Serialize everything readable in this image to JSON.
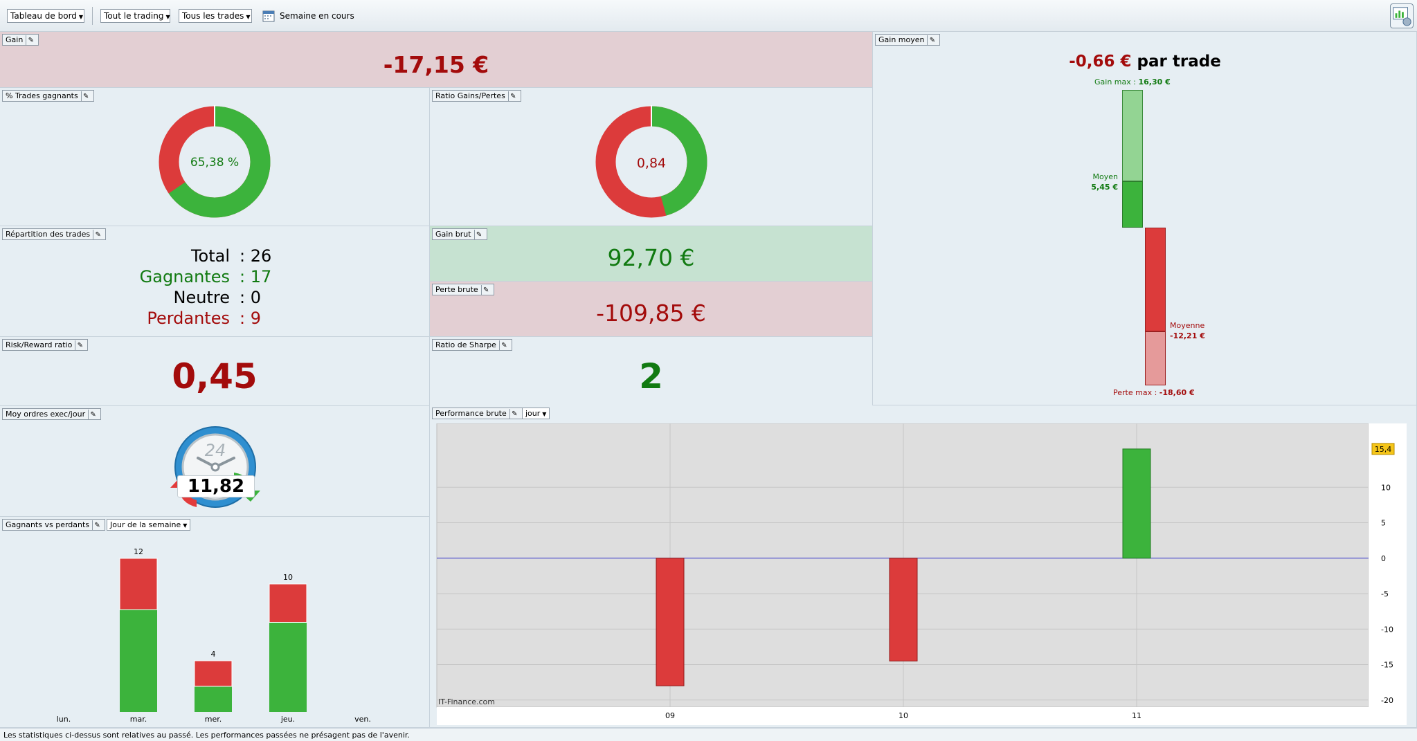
{
  "toolbar": {
    "dashboard": "Tableau de bord",
    "trading": "Tout le trading",
    "trades": "Tous les trades",
    "period": "Semaine en cours"
  },
  "gain": {
    "title": "Gain",
    "value": "-17,15 €"
  },
  "gain_moyen": {
    "title": "Gain moyen",
    "value": "-0,66 €",
    "suffix": "par trade",
    "max_label": "Gain max",
    "max_value": "16,30 €",
    "avg_gain_label": "Moyen",
    "avg_gain_value": "5,45 €",
    "avg_loss_label": "Moyenne",
    "avg_loss_value": "-12,21 €",
    "loss_max_label": "Perte max",
    "loss_max_value": "-18,60 €"
  },
  "win_pct": {
    "title": "% Trades gagnants",
    "value": "65,38 %",
    "fraction": 0.6538
  },
  "ratio_gp": {
    "title": "Ratio Gains/Pertes",
    "value": "0,84",
    "gain_share": 0.457
  },
  "repartition": {
    "title": "Répartition des trades",
    "rows": [
      {
        "label": "Total",
        "value": ": 26"
      },
      {
        "label": "Gagnantes",
        "value": ": 17"
      },
      {
        "label": "Neutre",
        "value": ": 0"
      },
      {
        "label": "Perdantes",
        "value": ": 9"
      }
    ]
  },
  "gain_brut": {
    "title": "Gain brut",
    "value": "92,70 €"
  },
  "perte_brute": {
    "title": "Perte brute",
    "value": "-109,85 €"
  },
  "risk_reward": {
    "title": "Risk/Reward ratio",
    "value": "0,45"
  },
  "sharpe": {
    "title": "Ratio de Sharpe",
    "value": "2"
  },
  "ordres": {
    "title": "Moy ordres exec/jour",
    "value": "11,82",
    "clock": "24"
  },
  "winners_losers": {
    "title": "Gagnants vs perdants",
    "dropdown": "Jour de la semaine"
  },
  "performance": {
    "title": "Performance brute",
    "dropdown": "jour",
    "watermark": "IT-Finance.com",
    "last_value": "15,4"
  },
  "footer": "Les statistiques ci-dessus sont relatives au passé. Les performances passées ne présagent pas de l'avenir.",
  "colors": {
    "green": "#3cb33c",
    "red": "#dc3b3b",
    "dark_red": "#a30b0b",
    "dark_green": "#117a11"
  },
  "chart_data": [
    {
      "type": "bar",
      "name": "Gagnants vs perdants",
      "categories": [
        "lun.",
        "mar.",
        "mer.",
        "jeu.",
        "ven."
      ],
      "series": [
        {
          "name": "Gagnants",
          "values": [
            0,
            8,
            2,
            7,
            0
          ]
        },
        {
          "name": "Perdants",
          "values": [
            0,
            4,
            2,
            3,
            0
          ]
        }
      ],
      "totals": [
        0,
        12,
        4,
        10,
        0
      ],
      "ylim": [
        0,
        12
      ]
    },
    {
      "type": "bar",
      "name": "Performance brute",
      "categories": [
        "09",
        "10",
        "11"
      ],
      "values": [
        -18.0,
        -14.5,
        15.4
      ],
      "yticks": [
        10,
        5,
        0,
        -5,
        -10,
        -15,
        -20
      ],
      "ylim": [
        -21,
        19
      ],
      "grid": true
    }
  ]
}
